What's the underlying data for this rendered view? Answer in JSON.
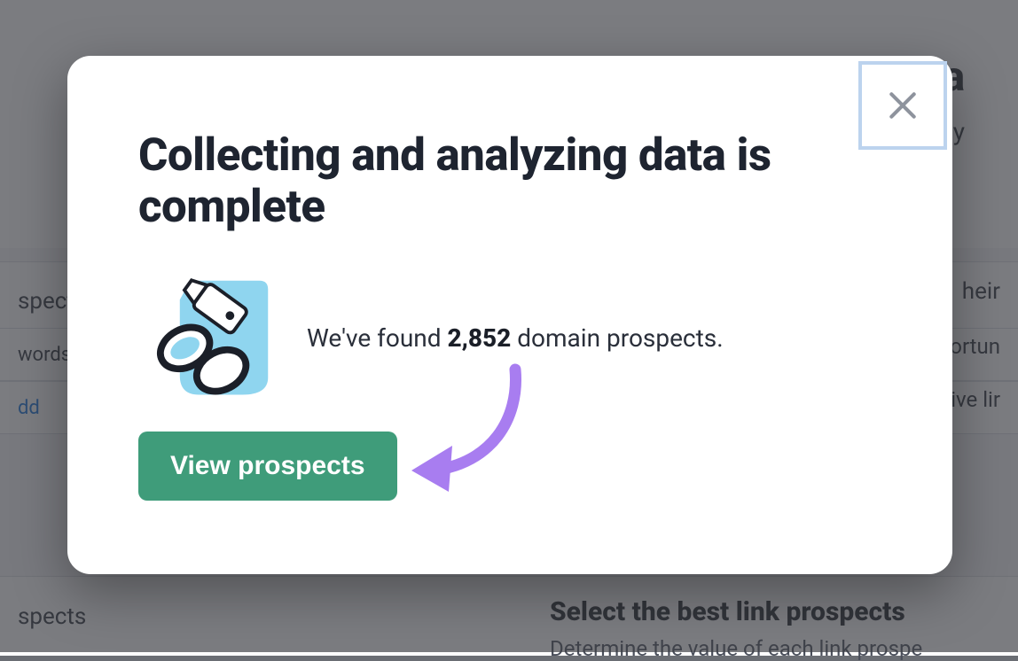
{
  "background": {
    "headline_suffix": "te ba",
    "sub_suffix": "ality",
    "row1_left": "spects",
    "row1_right": "heir",
    "row2_left": "words",
    "row2_right_a": "ortun",
    "row2_right_b": "ive lir",
    "row3_left": "dd",
    "row4_left": "spects",
    "select_heading": "Select the best link prospects",
    "select_sub": "Determine the value of each link prospe"
  },
  "modal": {
    "title": "Collecting and analyzing data is complete",
    "message_prefix": "We've found ",
    "count": "2,852",
    "message_suffix": " domain prospects.",
    "cta_label": "View prospects"
  }
}
